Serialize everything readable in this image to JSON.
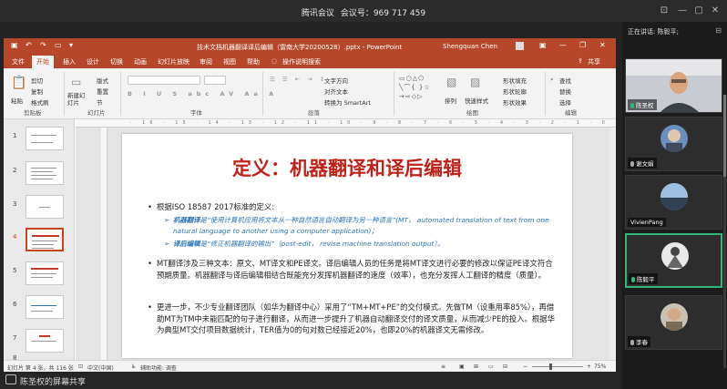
{
  "meeting": {
    "title_app": "腾讯会议",
    "title_id": "会议号：969 717 459"
  },
  "ppt": {
    "doc_title": "技术文档机器翻译译后编辑（雷南大学20200528）.pptx - PowerPoint",
    "user": "Shengquan Chen",
    "menu": [
      "文件",
      "开始",
      "插入",
      "设计",
      "切换",
      "动画",
      "幻灯片放映",
      "审阅",
      "视图",
      "帮助"
    ],
    "tell_me": "操作说明搜索",
    "share": "共享",
    "ribbon": {
      "paste": "粘贴",
      "cut": "剪切",
      "copy": "复制",
      "format_painter": "格式刷",
      "new_slide": "新建幻灯片",
      "layout": "版式",
      "reset": "重置",
      "section": "节",
      "text_direction": "文字方向",
      "align_text": "对齐文本",
      "smartart": "转换为 SmartArt",
      "arrange": "排列",
      "quick_styles": "快速样式",
      "shape_fill": "形状填充",
      "shape_outline": "形状轮廓",
      "shape_effects": "形状效果",
      "find": "查找",
      "replace": "替换",
      "select": "选择",
      "groups": [
        "剪贴板",
        "幻灯片",
        "字体",
        "段落",
        "绘图",
        "编辑"
      ]
    },
    "thumbnails": [
      "1",
      "2",
      "3",
      "4",
      "5",
      "6",
      "7",
      "8"
    ],
    "active_thumb": "4",
    "ruler": "· 16 · 15 · 14 · 13 · 12 · 11 · 10 · 9 · 8 · 7 · 6 · 5 · 4 · 3 · 2 · 1 · 0 · 1 · 2 · 3 · 4 · 5 · 6 · 7 · 8 · 9 · 10 · 11 · 12 · 13 · 14 · 15 · 16 ·",
    "slide": {
      "title": "定义：机器翻译和译后编辑",
      "bullet1": "根据ISO 18587 2017标准的定义:",
      "sub1_term": "机器翻译",
      "sub1_text": "是“使用计算机应用将文本从一种自然语言自动翻译为另一种语言”(MT， automated translation of text from one natural language to another using a computer application)；",
      "sub2_term": "译后编辑",
      "sub2_text": "是“修正机器翻译的输出”（post-edit， revise machine translation output）。",
      "bullet2": "MT翻译涉及三种文本：原文、MT译文和PE译文。译后编辑人员的任务是将MT译文进行必要的修改以保证PE译文符合预期质量。机器翻译与译后编辑相结合既能充分发挥机器翻译的速度（效率），也充分发挥人工翻译的精度（质量）。",
      "bullet3": "更进一步，不少专业翻译团队（如华为翻译中心）采用了“TM+MT+PE”的交付模式。先做TM（设重用率85%），再借助MT为TM中未能匹配的句子进行翻译，从而进一步提升了机器自动翻译交付的译文质量，从而减少PE的投入。根据华为典型MT交付项目数据统计，TER值为0的句对数已经接近20%，也即20%的机器译文无需修改。"
    },
    "status": {
      "slide_info": "幻灯片 第 4 张，共 116 张",
      "language": "中文(中国)",
      "accessibility": "辅助功能: 调查",
      "zoom": "75%",
      "zoom_level": 0.75
    }
  },
  "share_bar": {
    "text": "陈圣权的屏幕共享"
  },
  "panel": {
    "speaking": "正在讲话: 陈毅平;",
    "participants": [
      {
        "name": "陈圣权",
        "kind": "video"
      },
      {
        "name": "谢文娟",
        "kind": "avatar"
      },
      {
        "name": "VivienPang",
        "kind": "avatar"
      },
      {
        "name": "陈毅平",
        "kind": "avatar"
      },
      {
        "name": "李春",
        "kind": "avatar"
      }
    ]
  },
  "colors": {
    "ppt_accent": "#b7472a",
    "title_red": "#c0221a",
    "link_blue": "#2e74b5",
    "speaking_green": "#31b67a"
  }
}
